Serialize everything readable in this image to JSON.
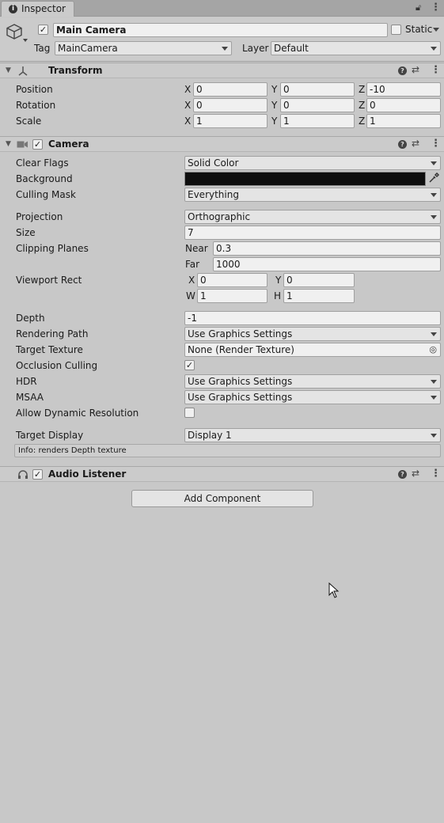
{
  "window": {
    "tab_label": "Inspector"
  },
  "object": {
    "name": "Main Camera",
    "static_label": "Static",
    "tag_label": "Tag",
    "tag_value": "MainCamera",
    "layer_label": "Layer",
    "layer_value": "Default"
  },
  "transform": {
    "title": "Transform",
    "rows": [
      {
        "label": "Position",
        "x": "0",
        "y": "0",
        "z": "-10"
      },
      {
        "label": "Rotation",
        "x": "0",
        "y": "0",
        "z": "0"
      },
      {
        "label": "Scale",
        "x": "1",
        "y": "1",
        "z": "1"
      }
    ],
    "axis_x": "X",
    "axis_y": "Y",
    "axis_z": "Z"
  },
  "camera": {
    "title": "Camera",
    "clear_flags_label": "Clear Flags",
    "clear_flags_value": "Solid Color",
    "background_label": "Background",
    "background_color": "#0e0e0e",
    "culling_mask_label": "Culling Mask",
    "culling_mask_value": "Everything",
    "projection_label": "Projection",
    "projection_value": "Orthographic",
    "size_label": "Size",
    "size_value": "7",
    "clipping_label": "Clipping Planes",
    "near_label": "Near",
    "near_value": "0.3",
    "far_label": "Far",
    "far_value": "1000",
    "viewport_label": "Viewport Rect",
    "vp_x_label": "X",
    "vp_x": "0",
    "vp_y_label": "Y",
    "vp_y": "0",
    "vp_w_label": "W",
    "vp_w": "1",
    "vp_h_label": "H",
    "vp_h": "1",
    "depth_label": "Depth",
    "depth_value": "-1",
    "rendering_path_label": "Rendering Path",
    "rendering_path_value": "Use Graphics Settings",
    "target_texture_label": "Target Texture",
    "target_texture_value": "None (Render Texture)",
    "occlusion_label": "Occlusion Culling",
    "occlusion_checked": true,
    "hdr_label": "HDR",
    "hdr_value": "Use Graphics Settings",
    "msaa_label": "MSAA",
    "msaa_value": "Use Graphics Settings",
    "dynres_label": "Allow Dynamic Resolution",
    "dynres_checked": false,
    "target_display_label": "Target Display",
    "target_display_value": "Display 1",
    "info_text": "Info: renders Depth texture"
  },
  "audio_listener": {
    "title": "Audio Listener"
  },
  "add_component_label": "Add Component",
  "icons": {
    "info": "info-icon",
    "lock": "lock-icon",
    "kebab": "kebab-menu-icon",
    "gameobject": "gameobject-cube-icon",
    "transform": "transform-icon",
    "camera": "camera-icon",
    "audio": "headphones-icon",
    "help": "help-icon",
    "presets": "presets-icon",
    "eyedropper": "eyedropper-icon",
    "target": "object-picker-icon"
  }
}
